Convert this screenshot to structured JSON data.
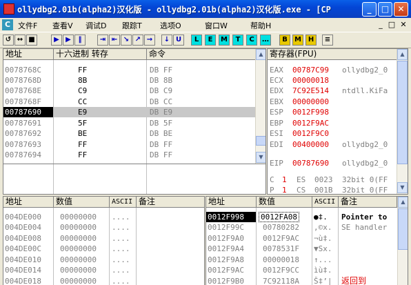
{
  "window": {
    "title": "ollydbg2.01b(alpha2)汉化版 - ollydbg2.01b(alpha2)汉化版.exe - [CP",
    "buttons": {
      "minimize": "_",
      "maximize": "□",
      "close": "✕"
    }
  },
  "menu": {
    "items": [
      "文件F",
      "查看V",
      "调试D",
      "跟踪T",
      "选项O",
      "窗口W",
      "帮助H"
    ],
    "mdi_buttons": [
      "_",
      "□",
      "✕"
    ]
  },
  "toolbar": {
    "buttons": [
      "↺",
      "↔",
      "■",
      "▶",
      "▶",
      "‖",
      "⇥",
      "⇤",
      "↘",
      "↗",
      "→",
      "↓",
      "U",
      "L",
      "E",
      "M",
      "T",
      "C",
      "…",
      "B",
      "M",
      "H",
      "≡"
    ]
  },
  "cpu": {
    "headers": {
      "address": "地址",
      "hex": "十六进制 转存",
      "command": "命令"
    },
    "rows": [
      {
        "address": "0078768C",
        "hex": "FF",
        "command": "DB FF"
      },
      {
        "address": "0078768D",
        "hex": "8B",
        "command": "DB 8B"
      },
      {
        "address": "0078768E",
        "hex": "C9",
        "command": "DB C9"
      },
      {
        "address": "0078768F",
        "hex": "CC",
        "command": "DB CC"
      },
      {
        "address": "00787690",
        "hex": "E9",
        "command": "DB E9"
      },
      {
        "address": "00787691",
        "hex": "5F",
        "command": "DB 5F"
      },
      {
        "address": "00787692",
        "hex": "BE",
        "command": "DB BE"
      },
      {
        "address": "00787693",
        "hex": "FF",
        "command": "DB FF"
      },
      {
        "address": "00787694",
        "hex": "FF",
        "command": "DB FF"
      }
    ]
  },
  "registers": {
    "header": "寄存器(FPU)",
    "rows": [
      {
        "name": "EAX",
        "value": "00787C99",
        "comment": "ollydbg2_0"
      },
      {
        "name": "ECX",
        "value": "00000018",
        "comment": ""
      },
      {
        "name": "EDX",
        "value": "7C92E514",
        "comment": "ntdll.KiFa"
      },
      {
        "name": "EBX",
        "value": "00000000",
        "comment": ""
      },
      {
        "name": "ESP",
        "value": "0012F998",
        "comment": ""
      },
      {
        "name": "EBP",
        "value": "0012F9AC",
        "comment": ""
      },
      {
        "name": "ESI",
        "value": "0012F9C0",
        "comment": ""
      },
      {
        "name": "EDI",
        "value": "00400000",
        "comment": "ollydbg2_0"
      }
    ],
    "eip": {
      "name": "EIP",
      "value": "00787690",
      "comment": "ollydbg2_0"
    },
    "flags": [
      {
        "flag": "C",
        "bit": "1",
        "seg": "ES",
        "sel": "0023",
        "info": "32bit 0(FF"
      },
      {
        "flag": "P",
        "bit": "1",
        "seg": "CS",
        "sel": "001B",
        "info": "32bit 0(FF"
      }
    ]
  },
  "dump": {
    "headers": {
      "address": "地址",
      "value": "数值",
      "ascii": "ASCII",
      "comment": "备注"
    },
    "rows": [
      {
        "address": "004DE000",
        "value": "00000000",
        "ascii": "...."
      },
      {
        "address": "004DE004",
        "value": "00000000",
        "ascii": "...."
      },
      {
        "address": "004DE008",
        "value": "00000000",
        "ascii": "...."
      },
      {
        "address": "004DE00C",
        "value": "00000000",
        "ascii": "...."
      },
      {
        "address": "004DE010",
        "value": "00000000",
        "ascii": "...."
      },
      {
        "address": "004DE014",
        "value": "00000000",
        "ascii": "...."
      },
      {
        "address": "004DE018",
        "value": "00000000",
        "ascii": "...."
      }
    ]
  },
  "stack": {
    "headers": {
      "address": "地址",
      "value": "数值",
      "ascii": "ASCII",
      "comment": "备注"
    },
    "rows": [
      {
        "address": "0012F998",
        "value": "0012FA08",
        "ascii": "●‡.",
        "comment": "Pointer to"
      },
      {
        "address": "0012F99C",
        "value": "00780282",
        "ascii": "‚©x.",
        "comment": "SE handler"
      },
      {
        "address": "0012F9A0",
        "value": "0012F9AC",
        "ascii": "¬ù‡.",
        "comment": ""
      },
      {
        "address": "0012F9A4",
        "value": "0078531F",
        "ascii": "▼Sx.",
        "comment": ""
      },
      {
        "address": "0012F9A8",
        "value": "00000018",
        "ascii": "↑...",
        "comment": ""
      },
      {
        "address": "0012F9AC",
        "value": "0012F9CC",
        "ascii": "ìù‡.",
        "comment": ""
      },
      {
        "address": "0012F9B0",
        "value": "7C92118A",
        "ascii": "Š‡’|",
        "comment": "返回到"
      }
    ]
  }
}
